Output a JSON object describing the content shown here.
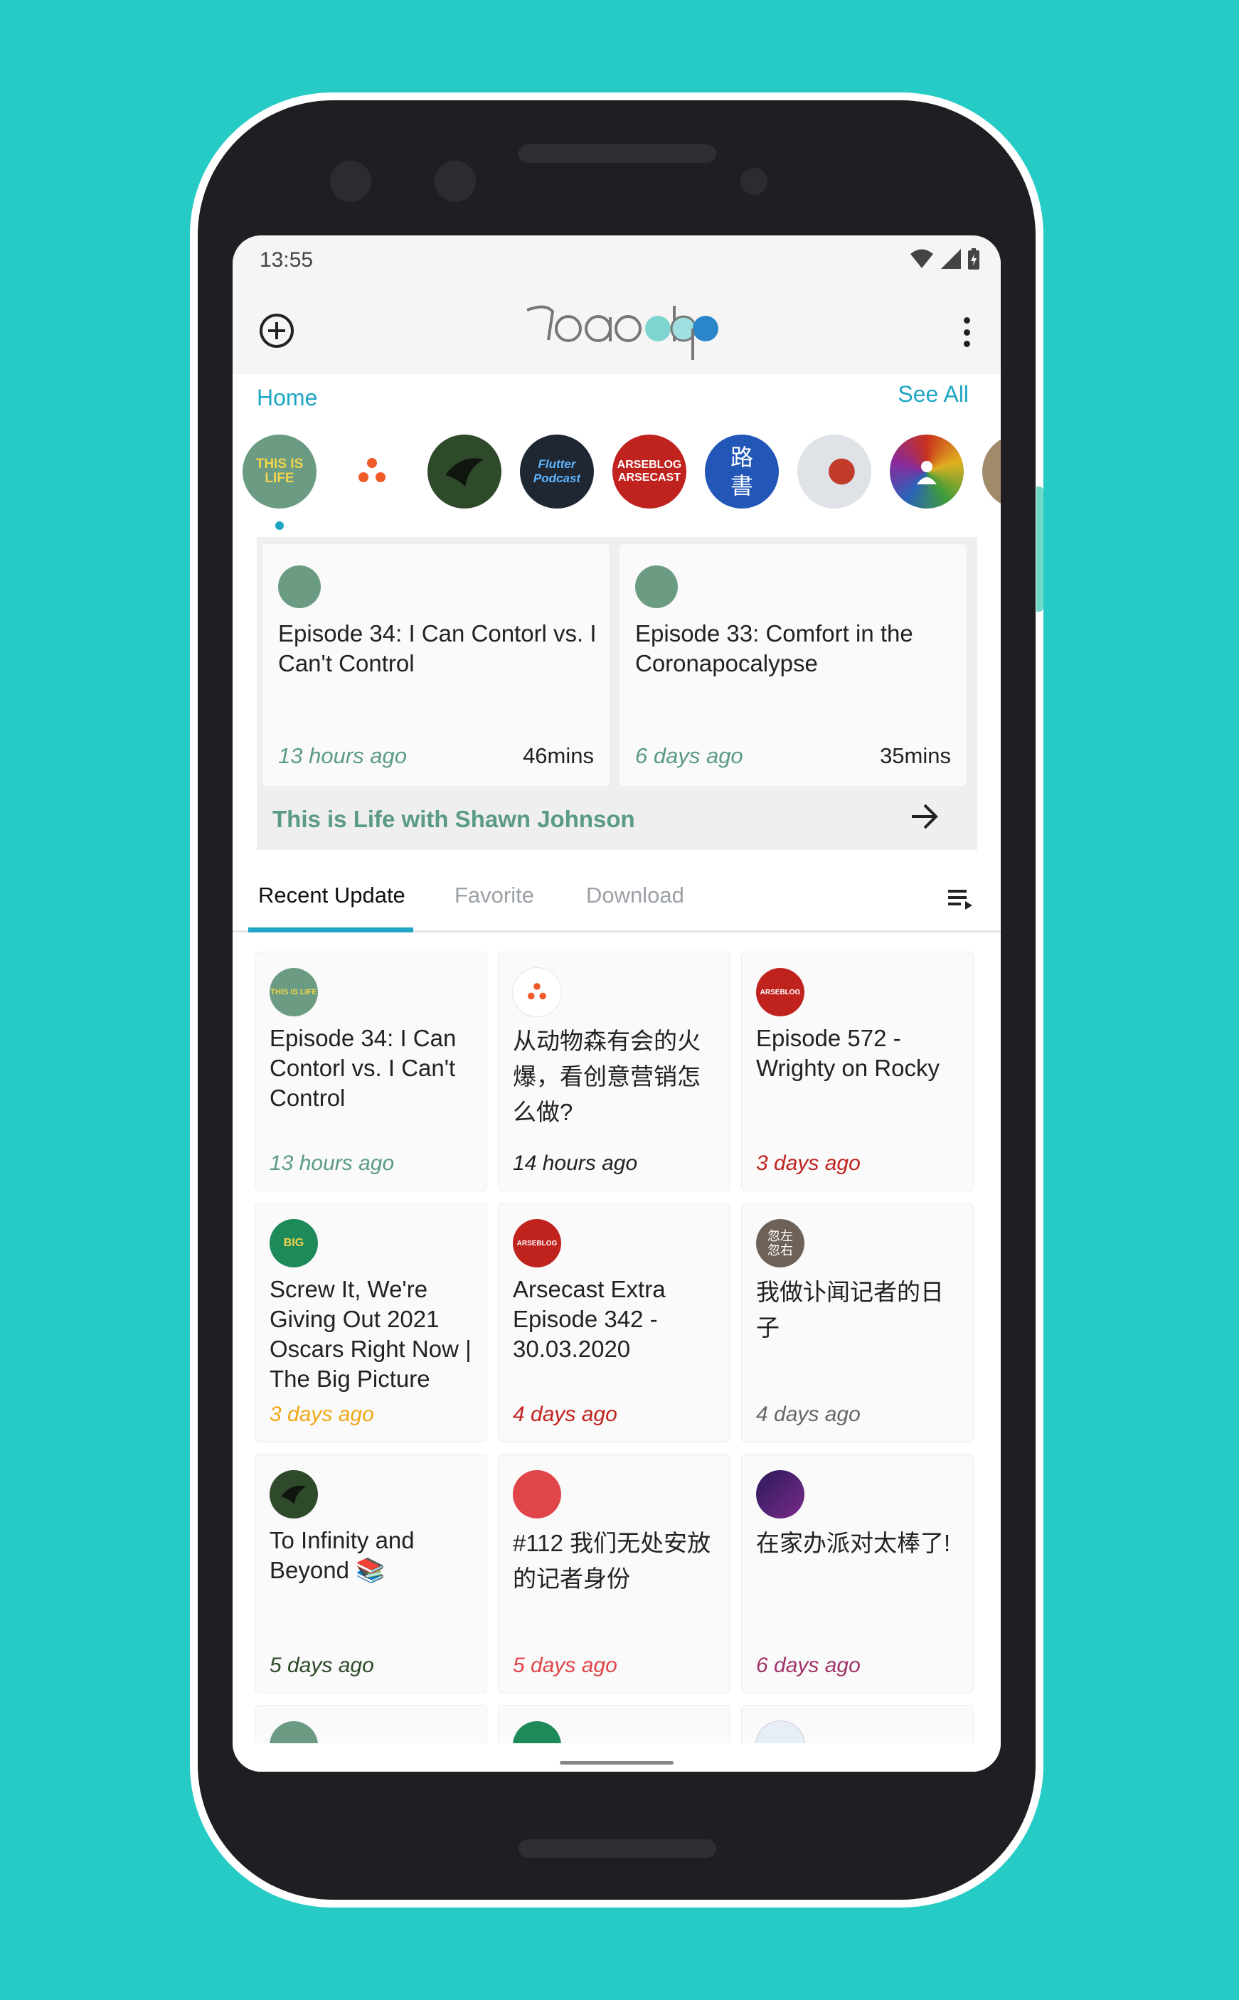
{
  "status": {
    "time": "13:55"
  },
  "app": {
    "logo_text": "teacdop"
  },
  "home": {
    "label": "Home",
    "see_all": "See All"
  },
  "avatars": [
    {
      "name": "this-is-life-avatar",
      "color": "#6b9c83",
      "text": "THIS IS LIFE"
    },
    {
      "name": "dots-avatar",
      "color": "#ffffff",
      "text": ""
    },
    {
      "name": "bird-avatar",
      "color": "#2f4a2a",
      "text": ""
    },
    {
      "name": "flutter-podcast-avatar",
      "color": "#1f2733",
      "text": "Flutter Podcast"
    },
    {
      "name": "arseblog-avatar",
      "color": "#c0221e",
      "text": "ARSEBLOG ARSECAST"
    },
    {
      "name": "lu-shu-avatar",
      "color": "#2257b8",
      "text": "路 書"
    },
    {
      "name": "portrait-avatar",
      "color": "#d9dde3",
      "text": ""
    },
    {
      "name": "colorful-avatar",
      "color": "#b3541e",
      "text": ""
    },
    {
      "name": "partial-avatar",
      "color": "#a08a6a",
      "text": ""
    }
  ],
  "featured": {
    "cards": [
      {
        "title": "Episode 34: I Can Contorl vs. I Can't Control",
        "ago": "13 hours ago",
        "duration": "46mins"
      },
      {
        "title": "Episode 33: Comfort in the Coronapocalypse",
        "ago": "6 days ago",
        "duration": "35mins"
      }
    ],
    "show_name": "This is Life with Shawn Johnson"
  },
  "tabs": {
    "recent": "Recent Update",
    "favorite": "Favorite",
    "download": "Download"
  },
  "grid": [
    {
      "title": "Episode 34: I Can Contorl vs. I Can't Control",
      "ago": "13 hours ago",
      "ago_color": "#5a9a86",
      "icon_color": "#6b9c83",
      "icon_text": "THIS IS LIFE"
    },
    {
      "title": "从动物森有会的火爆，看创意营销怎么做?",
      "ago": "14 hours ago",
      "ago_color": "#222222",
      "icon_color": "#ffffff",
      "icon_text": ""
    },
    {
      "title": "Episode 572 - Wrighty on Rocky",
      "ago": "3 days ago",
      "ago_color": "#c0221e",
      "icon_color": "#c0221e",
      "icon_text": "ARSEBLOG"
    },
    {
      "title": "Screw It, We're Giving Out 2021 Oscars Right Now | The Big Picture",
      "ago": "3 days ago",
      "ago_color": "#f0a818",
      "icon_color": "#1e8a5a",
      "icon_text": "BIG"
    },
    {
      "title": "Arsecast Extra Episode 342 - 30.03.2020",
      "ago": "4 days ago",
      "ago_color": "#c0221e",
      "icon_color": "#c0221e",
      "icon_text": "ARSEBLOG"
    },
    {
      "title": "我做讣闻记者的日子",
      "ago": "4 days ago",
      "ago_color": "#666666",
      "icon_color": "#6e6258",
      "icon_text": "忽左 忽右"
    },
    {
      "title": "To Infinity and Beyond 📚",
      "ago": "5 days ago",
      "ago_color": "#2f4a2a",
      "icon_color": "#2f4a2a",
      "icon_text": ""
    },
    {
      "title": "#112 我们无处安放的记者身份",
      "ago": "5 days ago",
      "ago_color": "#e0454a",
      "icon_color": "#e0454a",
      "icon_text": ""
    },
    {
      "title": "在家办派对太棒了!",
      "ago": "6 days ago",
      "ago_color": "#a0336a",
      "icon_color": "#2a1a5a",
      "icon_text": ""
    }
  ]
}
